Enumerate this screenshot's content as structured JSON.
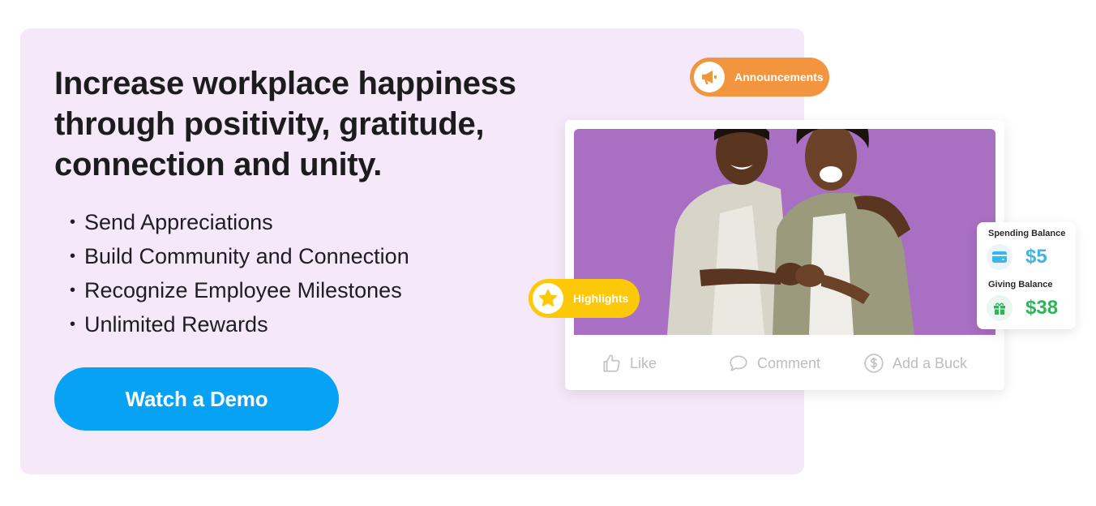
{
  "hero": {
    "headline": "Increase workplace happiness through positivity, gratitude, connection and unity.",
    "features": [
      "Send Appreciations",
      "Build Community and Connection",
      "Recognize Employee Milestones",
      "Unlimited Rewards"
    ],
    "bullet": "•",
    "cta_label": "Watch a Demo"
  },
  "badges": {
    "announcements": {
      "label": "Announcements",
      "icon": "megaphone-icon",
      "color": "#f3953f"
    },
    "highlights": {
      "label": "Highlights",
      "icon": "star-icon",
      "color": "#fdc808"
    }
  },
  "post_card": {
    "photo_background": "#a86fc2",
    "actions": [
      {
        "label": "Like",
        "icon": "thumbs-up-icon"
      },
      {
        "label": "Comment",
        "icon": "comment-icon"
      },
      {
        "label": "Add a Buck",
        "icon": "dollar-circle-icon"
      }
    ]
  },
  "balances": {
    "spending": {
      "label": "Spending Balance",
      "amount": "$5",
      "icon": "credit-card-icon",
      "color": "#3fb4e5"
    },
    "giving": {
      "label": "Giving Balance",
      "amount": "$38",
      "icon": "gift-icon",
      "color": "#2bb65a"
    }
  },
  "colors": {
    "panel_background": "#f5e8f8",
    "cta_background": "#08a2f5"
  }
}
